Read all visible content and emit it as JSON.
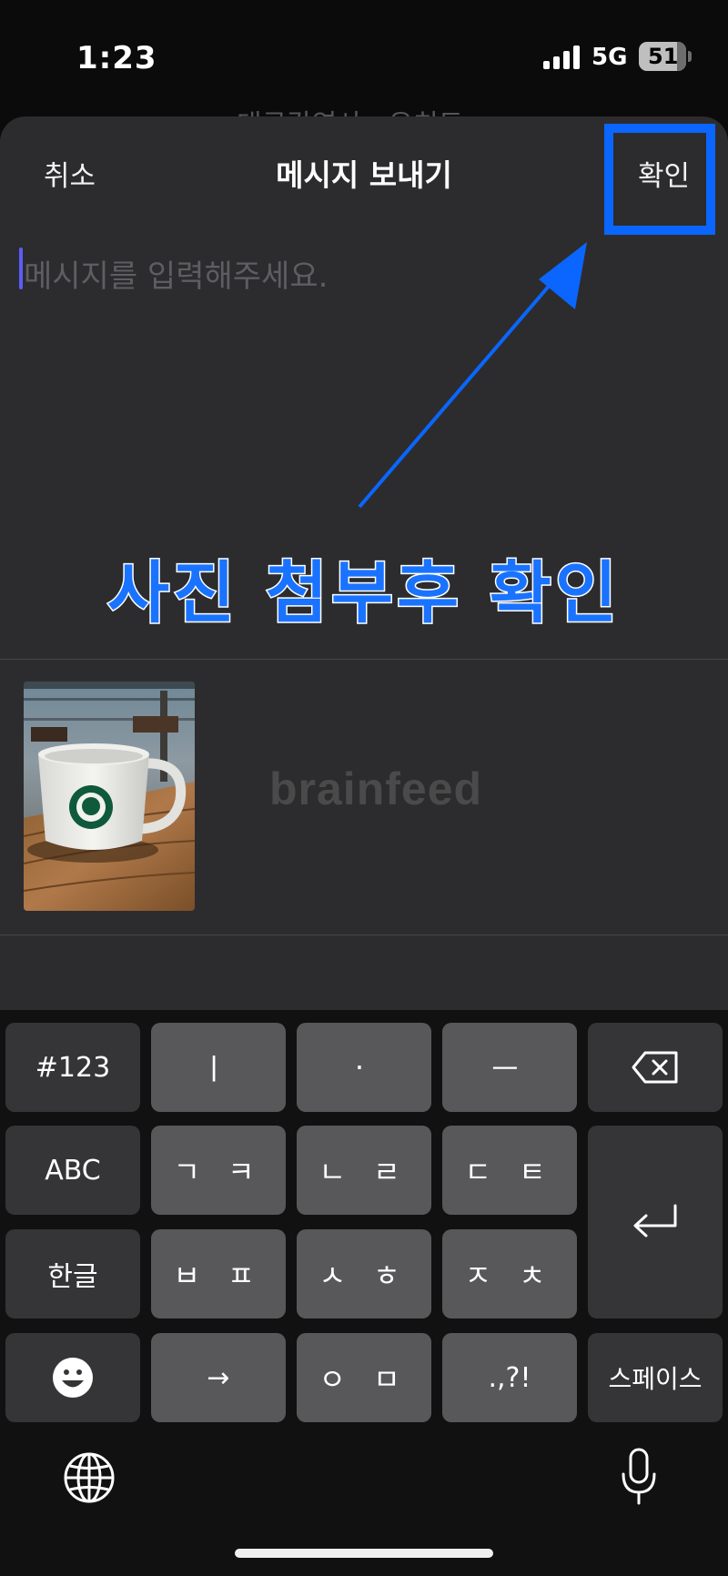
{
  "status_bar": {
    "time": "1:23",
    "network": "5G",
    "battery": "51"
  },
  "background_title": "대구각역사 · 유치도",
  "header": {
    "cancel_label": "취소",
    "title": "메시지 보내기",
    "confirm_label": "확인"
  },
  "message_input": {
    "placeholder": "메시지를 입력해주세요.",
    "value": ""
  },
  "annotation": {
    "text": "사진 첨부후 확인",
    "color": "#1a73ff"
  },
  "attachment": {
    "watermark": "brainfeed"
  },
  "keyboard": {
    "row1": [
      "#123",
      "ㅣ",
      "·",
      "ㅡ"
    ],
    "row2": [
      "ABC",
      "ㄱ ㅋ",
      "ㄴ ㄹ",
      "ㄷ ㅌ"
    ],
    "row3": [
      "한글",
      "ㅂ ㅍ",
      "ㅅ ㅎ",
      "ㅈ ㅊ"
    ],
    "row4": [
      "→",
      "ㅇ ㅁ",
      ".,?!",
      "스페이스"
    ],
    "icons": [
      "backspace-icon",
      "return-icon",
      "emoji-icon",
      "globe-icon",
      "microphone-icon"
    ]
  },
  "colors": {
    "sheet_bg": "#2c2c2e",
    "highlight": "#0a66ff",
    "key_light": "#58585a",
    "key_dark": "#353537"
  }
}
